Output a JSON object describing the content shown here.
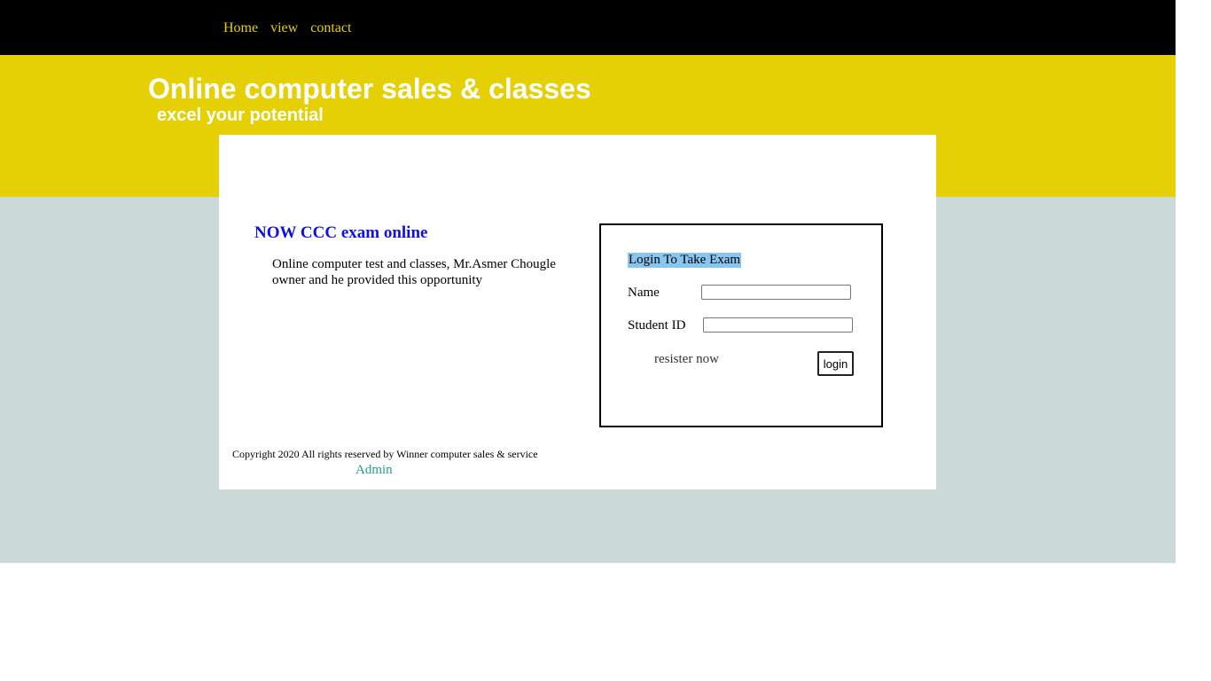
{
  "nav": {
    "items": [
      "Home",
      "view",
      "contact"
    ]
  },
  "header": {
    "title": "Online computer sales & classes",
    "tagline": "excel your potential"
  },
  "promo": {
    "title": "NOW CCC exam online",
    "text": "Online computer test and classes, Mr.Asmer Chougle owner and he provided this opportunity"
  },
  "login": {
    "heading": "Login To Take Exam",
    "name_label": "Name",
    "name_value": "",
    "student_id_label": "Student ID",
    "student_id_value": "",
    "register_label": "resister now",
    "button_label": "login"
  },
  "footer": {
    "copyright": "Copyright 2020 All rights reserved by Winner computer sales & service",
    "admin_label": "Admin"
  },
  "colors": {
    "topbar": "#000000",
    "nav_link": "#e5d006",
    "banner": "#e5d006",
    "lower_bg": "#cbdad7",
    "promo_title": "#1010e0",
    "heading_highlight": "#89c6ef",
    "admin_link": "#2a9a8a"
  }
}
